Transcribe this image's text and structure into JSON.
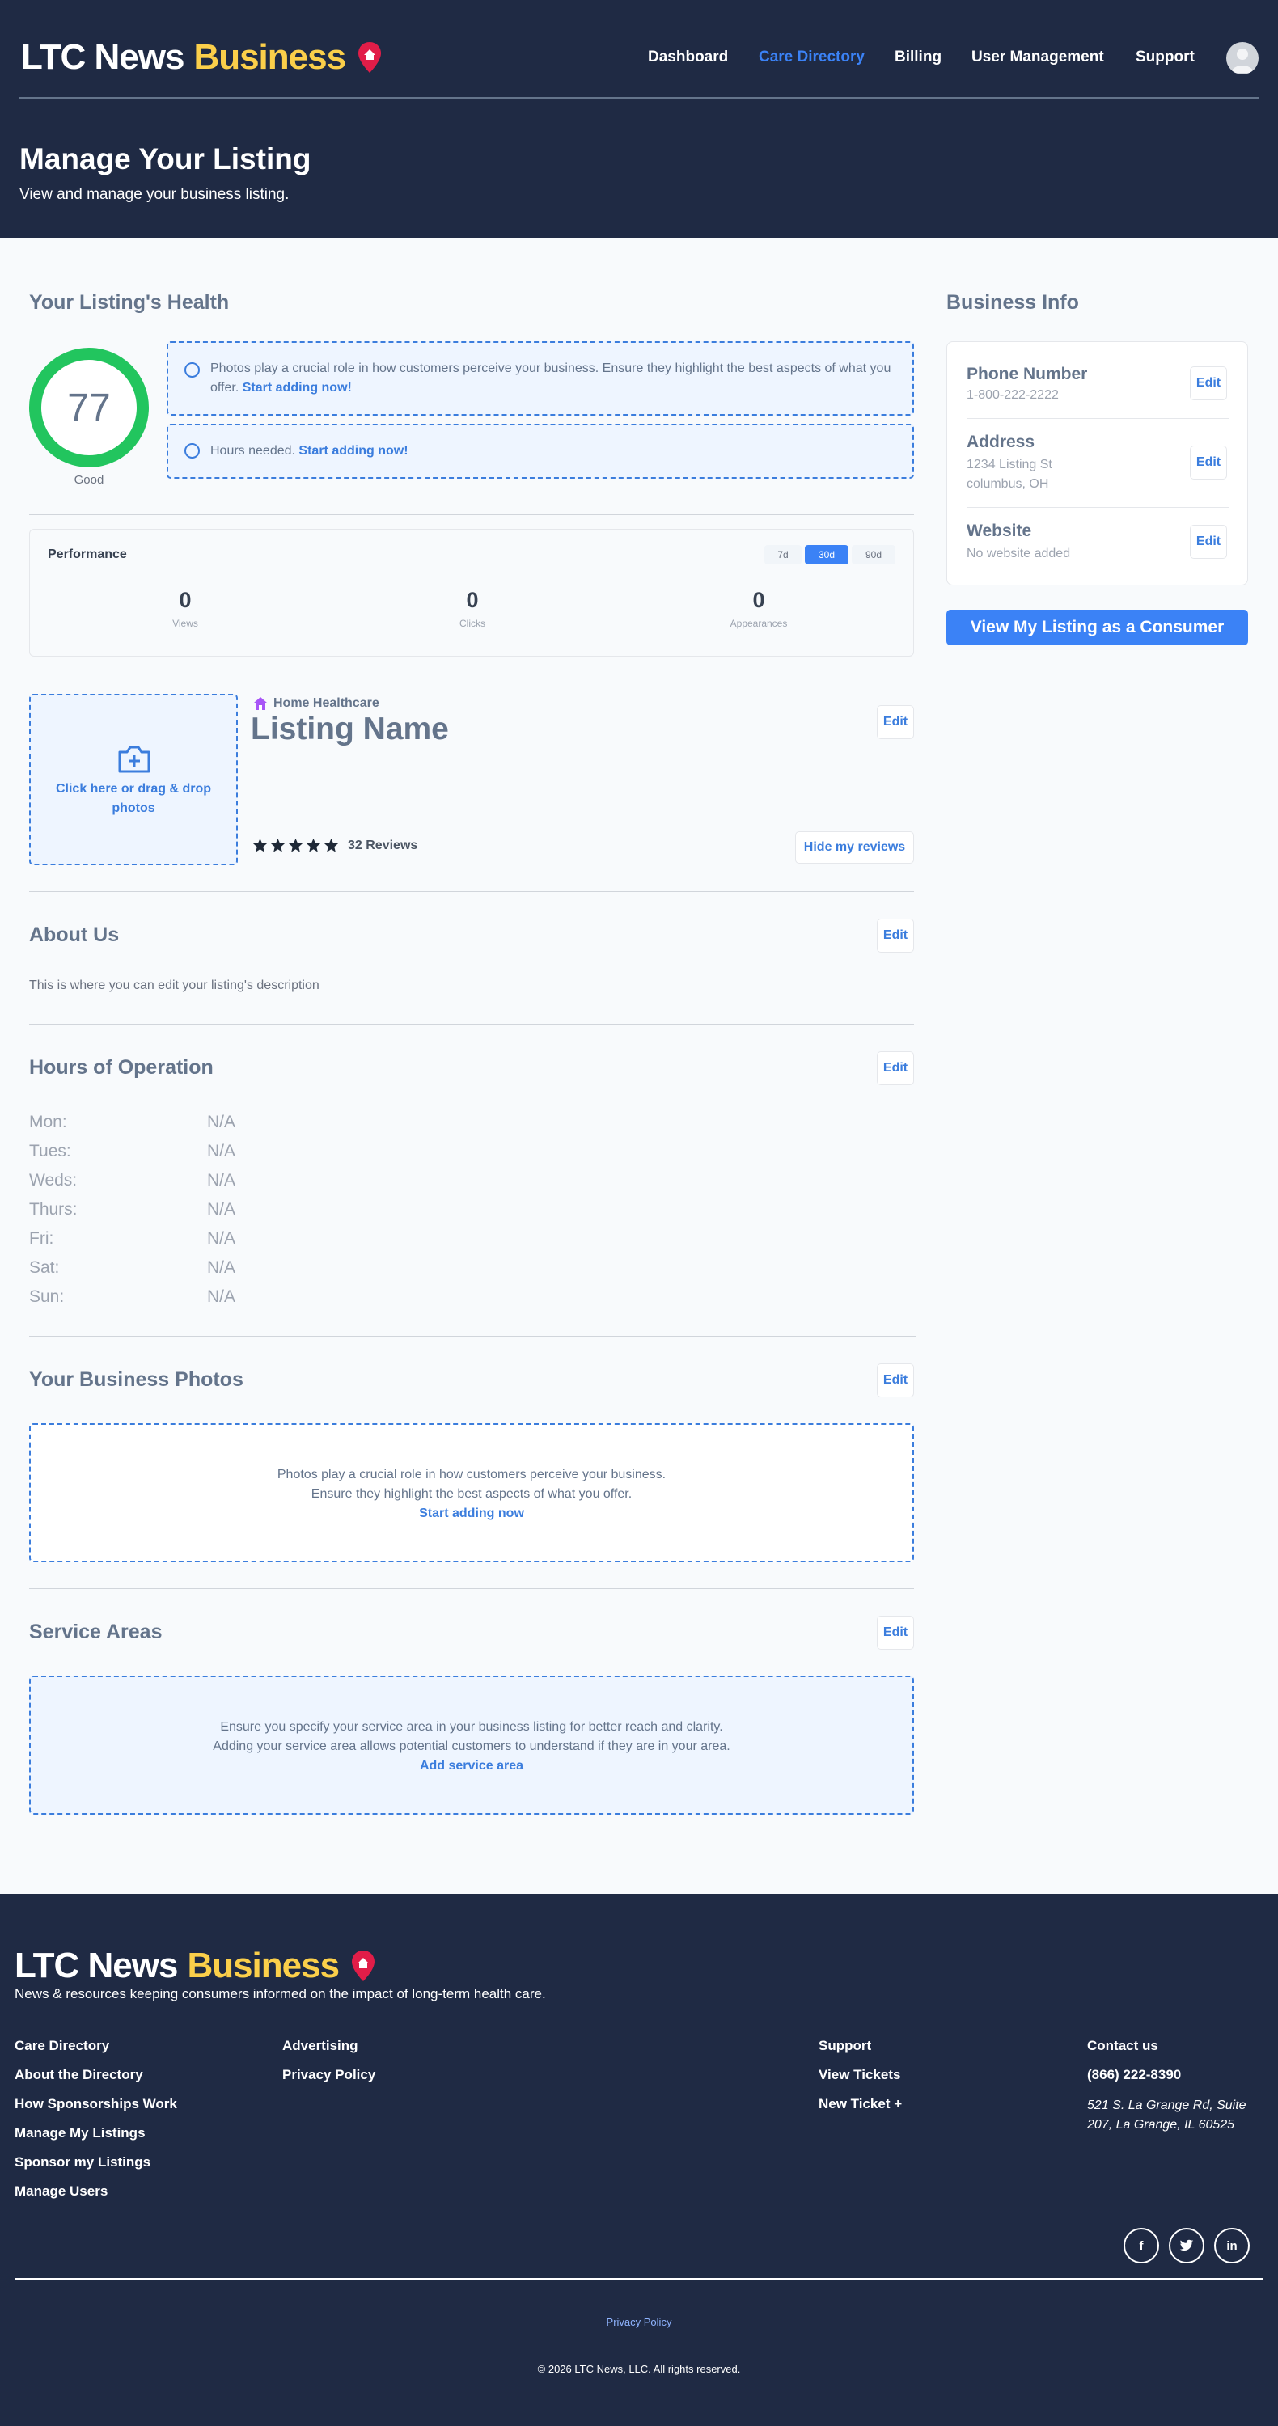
{
  "brand": {
    "name_white": "LTC News",
    "name_yellow": "Business"
  },
  "nav": [
    {
      "label": "Dashboard"
    },
    {
      "label": "Care Directory",
      "active": true
    },
    {
      "label": "Billing"
    },
    {
      "label": "User Management"
    },
    {
      "label": "Support"
    }
  ],
  "page": {
    "title": "Manage Your Listing",
    "subtitle": "View and manage your business listing."
  },
  "health": {
    "heading": "Your Listing's Health",
    "score": "77",
    "score_label": "Good",
    "tip1_text": "Photos play a crucial role in how customers perceive your business. Ensure they highlight the best aspects of what you offer.",
    "tip1_link": "Start adding now!",
    "tip2_text": "Hours needed.",
    "tip2_link": "Start adding now!"
  },
  "performance": {
    "title": "Performance",
    "ranges": [
      "7d",
      "30d",
      "90d"
    ],
    "active_range": "30d",
    "stats": [
      {
        "value": "0",
        "label": "Views"
      },
      {
        "value": "0",
        "label": "Clicks"
      },
      {
        "value": "0",
        "label": "Appearances"
      }
    ]
  },
  "listing": {
    "photo_prompt": "Click here or drag & drop photos",
    "category": "Home Healthcare",
    "name": "Listing Name",
    "rating": 5,
    "reviews": "32 Reviews",
    "edit_label": "Edit",
    "hide_reviews_label": "Hide my reviews"
  },
  "about": {
    "heading": "About Us",
    "edit_label": "Edit",
    "description": "This is where you can edit your listing's description"
  },
  "hours": {
    "heading": "Hours of Operation",
    "edit_label": "Edit",
    "days": [
      {
        "day": "Mon:",
        "value": "N/A"
      },
      {
        "day": "Tues:",
        "value": "N/A"
      },
      {
        "day": "Weds:",
        "value": "N/A"
      },
      {
        "day": "Thurs:",
        "value": "N/A"
      },
      {
        "day": "Fri:",
        "value": "N/A"
      },
      {
        "day": "Sat:",
        "value": "N/A"
      },
      {
        "day": "Sun:",
        "value": "N/A"
      }
    ]
  },
  "photos": {
    "heading": "Your Business Photos",
    "edit_label": "Edit",
    "line1": "Photos play a crucial role in how customers perceive your business.",
    "line2": "Ensure they highlight the best aspects of what you offer.",
    "link": "Start adding now"
  },
  "service_areas": {
    "heading": "Service Areas",
    "edit_label": "Edit",
    "line1": "Ensure you specify your service area in your business listing for better reach and clarity.",
    "line2": "Adding your service area allows potential customers to understand if they are in your area.",
    "link": "Add service area"
  },
  "business_info": {
    "heading": "Business Info",
    "phone_label": "Phone Number",
    "phone_value": "1-800-222-2222",
    "address_label": "Address",
    "address_line1": "1234 Listing St",
    "address_line2": "columbus, OH",
    "website_label": "Website",
    "website_value": "No website added",
    "edit_label": "Edit",
    "cta": "View My Listing as a Consumer"
  },
  "footer": {
    "tagline": "News & resources keeping consumers informed on the impact of long-term health care.",
    "col1": [
      "Care Directory",
      "About the Directory",
      "How Sponsorships Work",
      "Manage My Listings",
      "Sponsor my Listings",
      "Manage Users"
    ],
    "col2": [
      "Advertising",
      "Privacy Policy"
    ],
    "col3": [
      "Support",
      "View Tickets",
      "New Ticket +"
    ],
    "contact_heading": "Contact us",
    "phone": "(866) 222-8390",
    "address": "521 S. La Grange Rd, Suite 207, La Grange, IL 60525",
    "social": [
      "facebook-icon",
      "twitter-icon",
      "linkedin-icon"
    ],
    "privacy": "Privacy Policy",
    "copyright": "© 2026 LTC News, LLC. All rights reserved."
  },
  "colors": {
    "navy": "#1f2a44",
    "accent": "#3b82f6",
    "brand_yellow": "#fbcf4a",
    "health_green": "#22c55e",
    "pin_red": "#e11d48"
  }
}
